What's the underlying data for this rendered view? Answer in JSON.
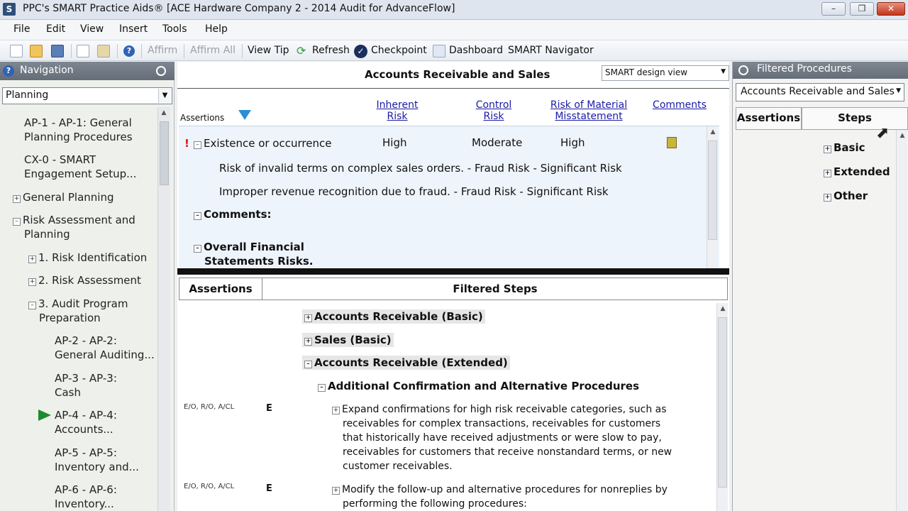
{
  "window": {
    "title": "PPC's SMART Practice Aids® [ACE Hardware Company 2 - 2014 Audit for AdvanceFlow]",
    "app_icon": "S",
    "controls": [
      "minimize-icon",
      "restore-icon",
      "close-icon"
    ]
  },
  "menu": [
    "File",
    "Edit",
    "View",
    "Insert",
    "Tools",
    "Help"
  ],
  "toolbar": {
    "affirm": "Affirm",
    "affirm_all": "Affirm All",
    "view_tip": "View Tip",
    "refresh": "Refresh",
    "checkpoint": "Checkpoint",
    "dashboard": "Dashboard",
    "smart_navigator": "SMART Navigator"
  },
  "navigation": {
    "title": "Navigation",
    "selected": "Planning",
    "items": [
      {
        "line1": "AP-1 - AP-1: General",
        "line2": "Planning Procedures"
      },
      {
        "line1": "CX-0 - SMART",
        "line2": "Engagement Setup..."
      },
      {
        "line1": "General Planning"
      },
      {
        "line1": "Risk Assessment and",
        "line2": "Planning"
      },
      {
        "line1": "1. Risk Identification"
      },
      {
        "line1": "2. Risk Assessment"
      },
      {
        "line1": "3. Audit Program",
        "line2": "Preparation"
      },
      {
        "line1": "AP-2 - AP-2:",
        "line2": "General Auditing..."
      },
      {
        "line1": "AP-3 - AP-3:",
        "line2": "Cash"
      },
      {
        "line1": "AP-4 - AP-4:",
        "line2": "Accounts..."
      },
      {
        "line1": "AP-5 - AP-5:",
        "line2": "Inventory and..."
      },
      {
        "line1": "AP-6 - AP-6:",
        "line2": "Inventory..."
      }
    ]
  },
  "main": {
    "title": "Accounts Receivable and Sales",
    "view_select": "SMART design view",
    "columns": {
      "assertions": "Assertions",
      "inherent_risk": [
        "Inherent",
        "Risk"
      ],
      "control_risk": [
        "Control",
        "Risk"
      ],
      "rmm": [
        "Risk of Material",
        "Misstatement"
      ],
      "comments": "Comments"
    },
    "assertion_row": {
      "flag": "!",
      "name": "Existence or occurrence",
      "inherent": "High",
      "control": "Moderate",
      "rmm": "High",
      "risks": [
        "Risk of invalid terms on complex sales orders. - Fraud Risk - Significant Risk",
        "Improper revenue recognition due to fraud. - Fraud Risk - Significant Risk"
      ]
    },
    "comments_label": "Comments:",
    "overall_label": [
      "Overall Financial",
      "Statements Risks."
    ],
    "bottom": {
      "assertions_head": "Assertions",
      "steps_head": "Filtered Steps",
      "sections": [
        "Accounts Receivable (Basic)",
        "Sales (Basic)",
        "Accounts Receivable (Extended)"
      ],
      "subsection": "Additional Confirmation and Alternative Procedures",
      "steps": [
        {
          "codes": "E/O, R/O, A/CL",
          "level": "E",
          "lines": [
            "Expand confirmations for high risk receivable categories, such as",
            "receivables for complex transactions, receivables for customers",
            "that historically have received adjustments or were slow to pay,",
            "receivables for customers that receive nonstandard terms, or new",
            "customer receivables."
          ]
        },
        {
          "codes": "E/O, R/O, A/CL",
          "level": "E",
          "lines": [
            "Modify the follow-up and alternative procedures for nonreplies by",
            "performing the following procedures:"
          ]
        }
      ]
    }
  },
  "filtered_procedures": {
    "title": "Filtered Procedures",
    "selected": "Accounts Receivable and Sales",
    "tabs": [
      "Assertions",
      "Steps"
    ],
    "items": [
      "Basic",
      "Extended",
      "Other"
    ]
  }
}
